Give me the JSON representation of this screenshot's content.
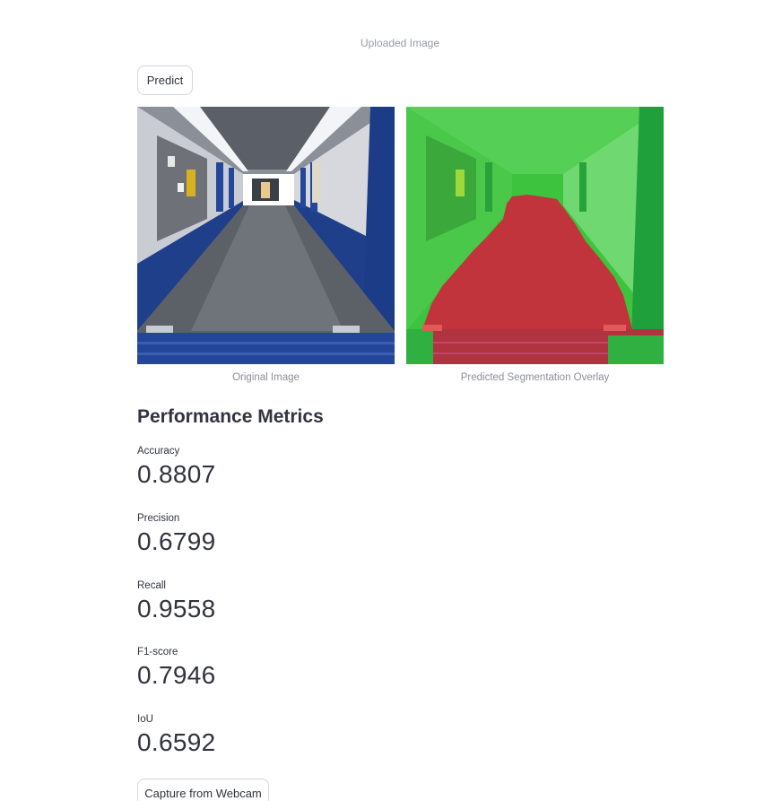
{
  "uploaded_caption": "Uploaded Image",
  "predict_label": "Predict",
  "images": {
    "original_caption": "Original Image",
    "overlay_caption": "Predicted Segmentation Overlay"
  },
  "section_title": "Performance Metrics",
  "metrics": [
    {
      "label": "Accuracy",
      "value": "0.8807"
    },
    {
      "label": "Precision",
      "value": "0.6799"
    },
    {
      "label": "Recall",
      "value": "0.9558"
    },
    {
      "label": "F1-score",
      "value": "0.7946"
    },
    {
      "label": "IoU",
      "value": "0.6592"
    }
  ],
  "webcam_label": "Capture from Webcam",
  "colors": {
    "overlay_wall": "#3cc83c",
    "overlay_floor": "#c83232",
    "text_primary": "#31333f",
    "caption": "#8c8e98"
  }
}
